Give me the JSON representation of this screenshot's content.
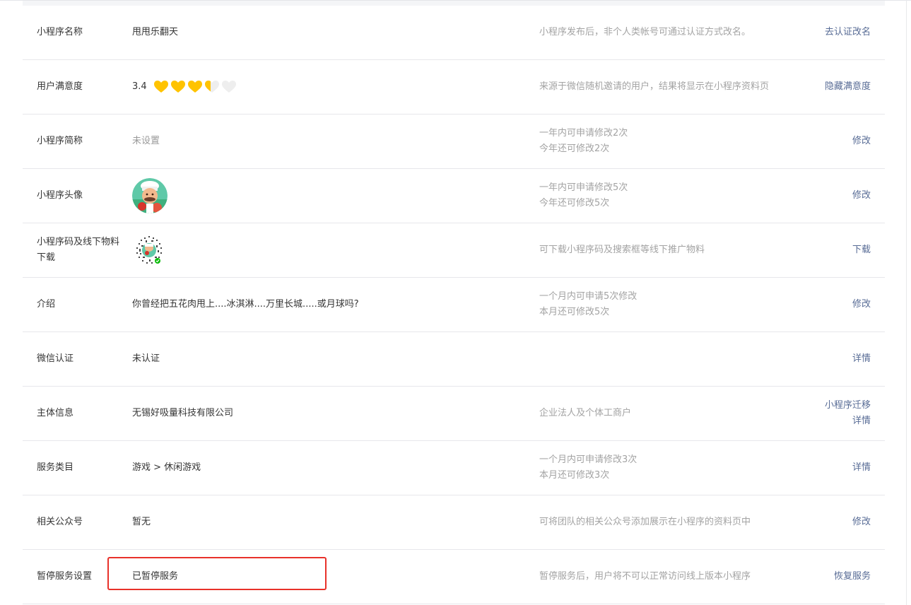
{
  "colors": {
    "link": "#576b95",
    "label": "#353535",
    "desc": "#a3a3a3",
    "heart_gold": "#ffc300",
    "heart_empty": "#eeeeee",
    "highlight_red": "#e8312a"
  },
  "rows": [
    {
      "label": "小程序名称",
      "value": "甩甩乐翻天",
      "desc": [
        "小程序发布后，非个人类帐号可通过认证方式改名。"
      ],
      "actions": [
        "去认证改名"
      ]
    },
    {
      "label": "用户满意度",
      "value": "3.4",
      "rating": 3.4,
      "rating_max": 5,
      "desc": [
        "来源于微信随机邀请的用户，结果将显示在小程序资料页"
      ],
      "actions": [
        "隐藏满意度"
      ]
    },
    {
      "label": "小程序简称",
      "value": "未设置",
      "desc": [
        "一年内可申请修改2次",
        "今年还可修改2次"
      ],
      "actions": [
        "修改"
      ]
    },
    {
      "label": "小程序头像",
      "value": "",
      "desc": [
        "一年内可申请修改5次",
        "今年还可修改5次"
      ],
      "actions": [
        "修改"
      ]
    },
    {
      "label": "小程序码及线下物料下载",
      "value": "",
      "desc": [
        "可下载小程序码及搜索框等线下推广物料"
      ],
      "actions": [
        "下载"
      ]
    },
    {
      "label": "介绍",
      "value": "你曾经把五花肉甩上....冰淇淋....万里长城.....或月球吗?",
      "desc": [
        "一个月内可申请5次修改",
        "本月还可修改5次"
      ],
      "actions": [
        "修改"
      ]
    },
    {
      "label": "微信认证",
      "value": "未认证",
      "desc": [],
      "actions": [
        "详情"
      ]
    },
    {
      "label": "主体信息",
      "value": "无锡好吸量科技有限公司",
      "desc": [
        "企业法人及个体工商户"
      ],
      "actions": [
        "小程序迁移",
        "详情"
      ]
    },
    {
      "label": "服务类目",
      "value": "游戏 > 休闲游戏",
      "desc": [
        "一个月内可申请修改3次",
        "本月还可修改3次"
      ],
      "actions": [
        "详情"
      ]
    },
    {
      "label": "相关公众号",
      "value": "暂无",
      "desc": [
        "可将团队的相关公众号添加展示在小程序的资料页中"
      ],
      "actions": [
        "修改"
      ]
    },
    {
      "label": "暂停服务设置",
      "value": "已暂停服务",
      "desc": [
        "暂停服务后，用户将不可以正常访问线上版本小程序"
      ],
      "actions": [
        "恢复服务"
      ]
    }
  ]
}
